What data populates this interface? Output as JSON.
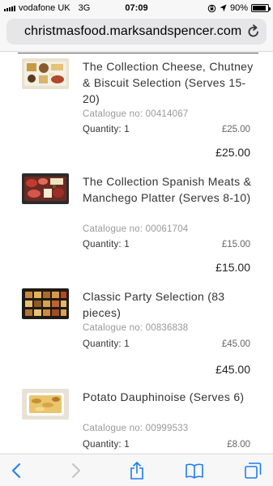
{
  "status_bar": {
    "carrier": "vodafone UK",
    "network": "3G",
    "time": "07:09",
    "battery_percent": "90%",
    "battery_level": 0.9
  },
  "browser": {
    "url": "christmasfood.marksandspencer.com"
  },
  "basket": {
    "catalogue_prefix": "Catalogue no:",
    "quantity_prefix": "Quantity:",
    "items": [
      {
        "name": "The Collection Cheese, Chutney & Biscuit Selection (Serves 15-20)",
        "catalogue_no": "00414067",
        "quantity": "1",
        "unit_price": "£25.00",
        "line_total": "£25.00",
        "thumb_icon": "cheese-platter-image"
      },
      {
        "name": "The Collection Spanish Meats & Manchego Platter (Serves 8-10)",
        "catalogue_no": "00061704",
        "quantity": "1",
        "unit_price": "£15.00",
        "line_total": "£15.00",
        "thumb_icon": "meat-platter-image"
      },
      {
        "name": "Classic Party Selection (83 pieces)",
        "catalogue_no": "00836838",
        "quantity": "1",
        "unit_price": "£45.00",
        "line_total": "£45.00",
        "thumb_icon": "party-food-image"
      },
      {
        "name": "Potato Dauphinoise (Serves 6)",
        "catalogue_no": "00999533",
        "quantity": "1",
        "unit_price": "£8.00",
        "line_total": "",
        "thumb_icon": "potato-dish-image"
      }
    ]
  },
  "toolbar": {
    "accent_color": "#1e7cf2",
    "disabled_color": "#c4c4c6"
  }
}
